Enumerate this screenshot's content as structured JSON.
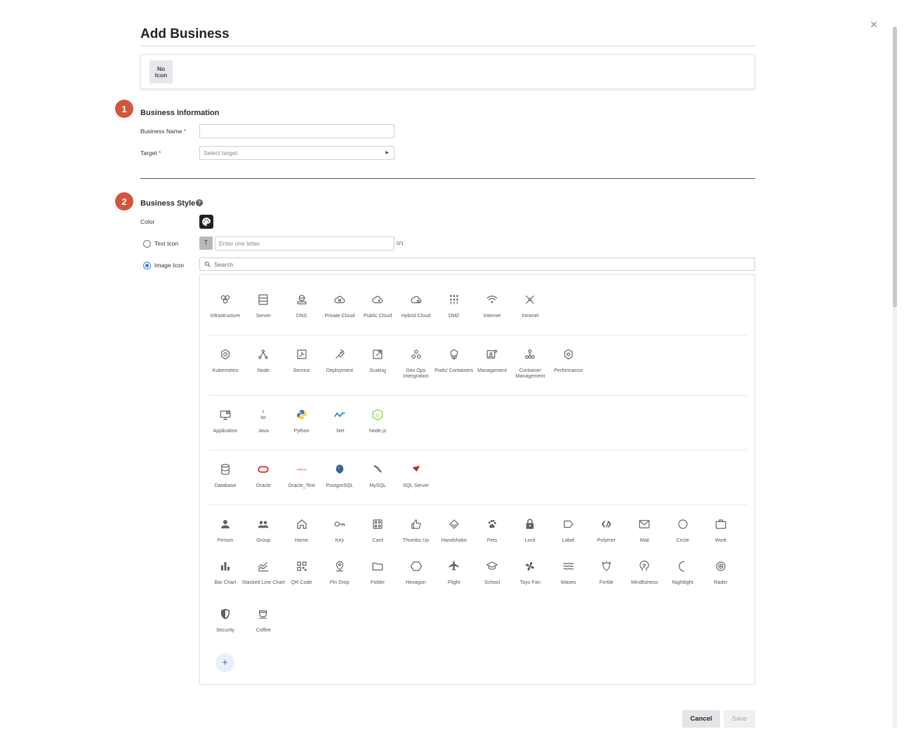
{
  "dialog": {
    "title": "Add Business",
    "close_label": "×"
  },
  "preview": {
    "no_icon_label": "No\nIcon"
  },
  "steps": [
    "1",
    "2"
  ],
  "business_information": {
    "section_title": "Business Information",
    "name_label": "Business Name",
    "name_value": "",
    "target_label": "Target",
    "target_placeholder": "Select target.",
    "required_mark": "*"
  },
  "business_style": {
    "section_title": "Business Style",
    "help_glyph": "?",
    "color_label": "Color",
    "text_icon_label": "Text Icon",
    "text_icon_glyph": "T",
    "text_icon_placeholder": "Enter one letter.",
    "text_icon_counter": "0/1",
    "image_icon_label": "Image Icon",
    "search_placeholder": "Search",
    "selected_mode": "Image Icon"
  },
  "icon_rows": [
    [
      "Infrastructure",
      "Server",
      "DNS",
      "Private Cloud",
      "Public Cloud",
      "Hybrid Cloud",
      "DMZ",
      "Internet",
      "Intranet"
    ],
    [
      "Kubernetes",
      "Node",
      "Service",
      "Deployment",
      "Scaling",
      "Dev Ops Intergration",
      "Pods/ Containers",
      "Management",
      "Container Management",
      "Performance"
    ],
    [
      "Application",
      "Java",
      "Python",
      ".Net",
      "Node.js"
    ],
    [
      "Database",
      "Oracle",
      "Oracle_Text",
      "PostgreSQL",
      "MySQL",
      "SQL Server"
    ],
    [
      "Person",
      "Group",
      "Home",
      "Key",
      "Card",
      "Thumbs Up",
      "Handshake",
      "Pets",
      "Lock",
      "Label",
      "Polymer",
      "Mail",
      "Circle",
      "Work"
    ],
    [
      "Bar Chart",
      "Stacked Line Chart",
      "QR Code",
      "Pin Drop",
      "Folder",
      "Hexagon",
      "Flight",
      "School",
      "Toys Fan",
      "Waves",
      "Fertile",
      "Mindfulness",
      "Nightlight",
      "Rader"
    ],
    [
      "Security",
      "Coffee"
    ]
  ],
  "add_icon_glyph": "+",
  "footer": {
    "cancel_label": "Cancel",
    "save_label": "Save"
  },
  "colors": {
    "accent": "#2f7de1",
    "step_badge": "#d2563d",
    "color_swatch": "#1f2227",
    "icon_gray": "#5f6368"
  }
}
